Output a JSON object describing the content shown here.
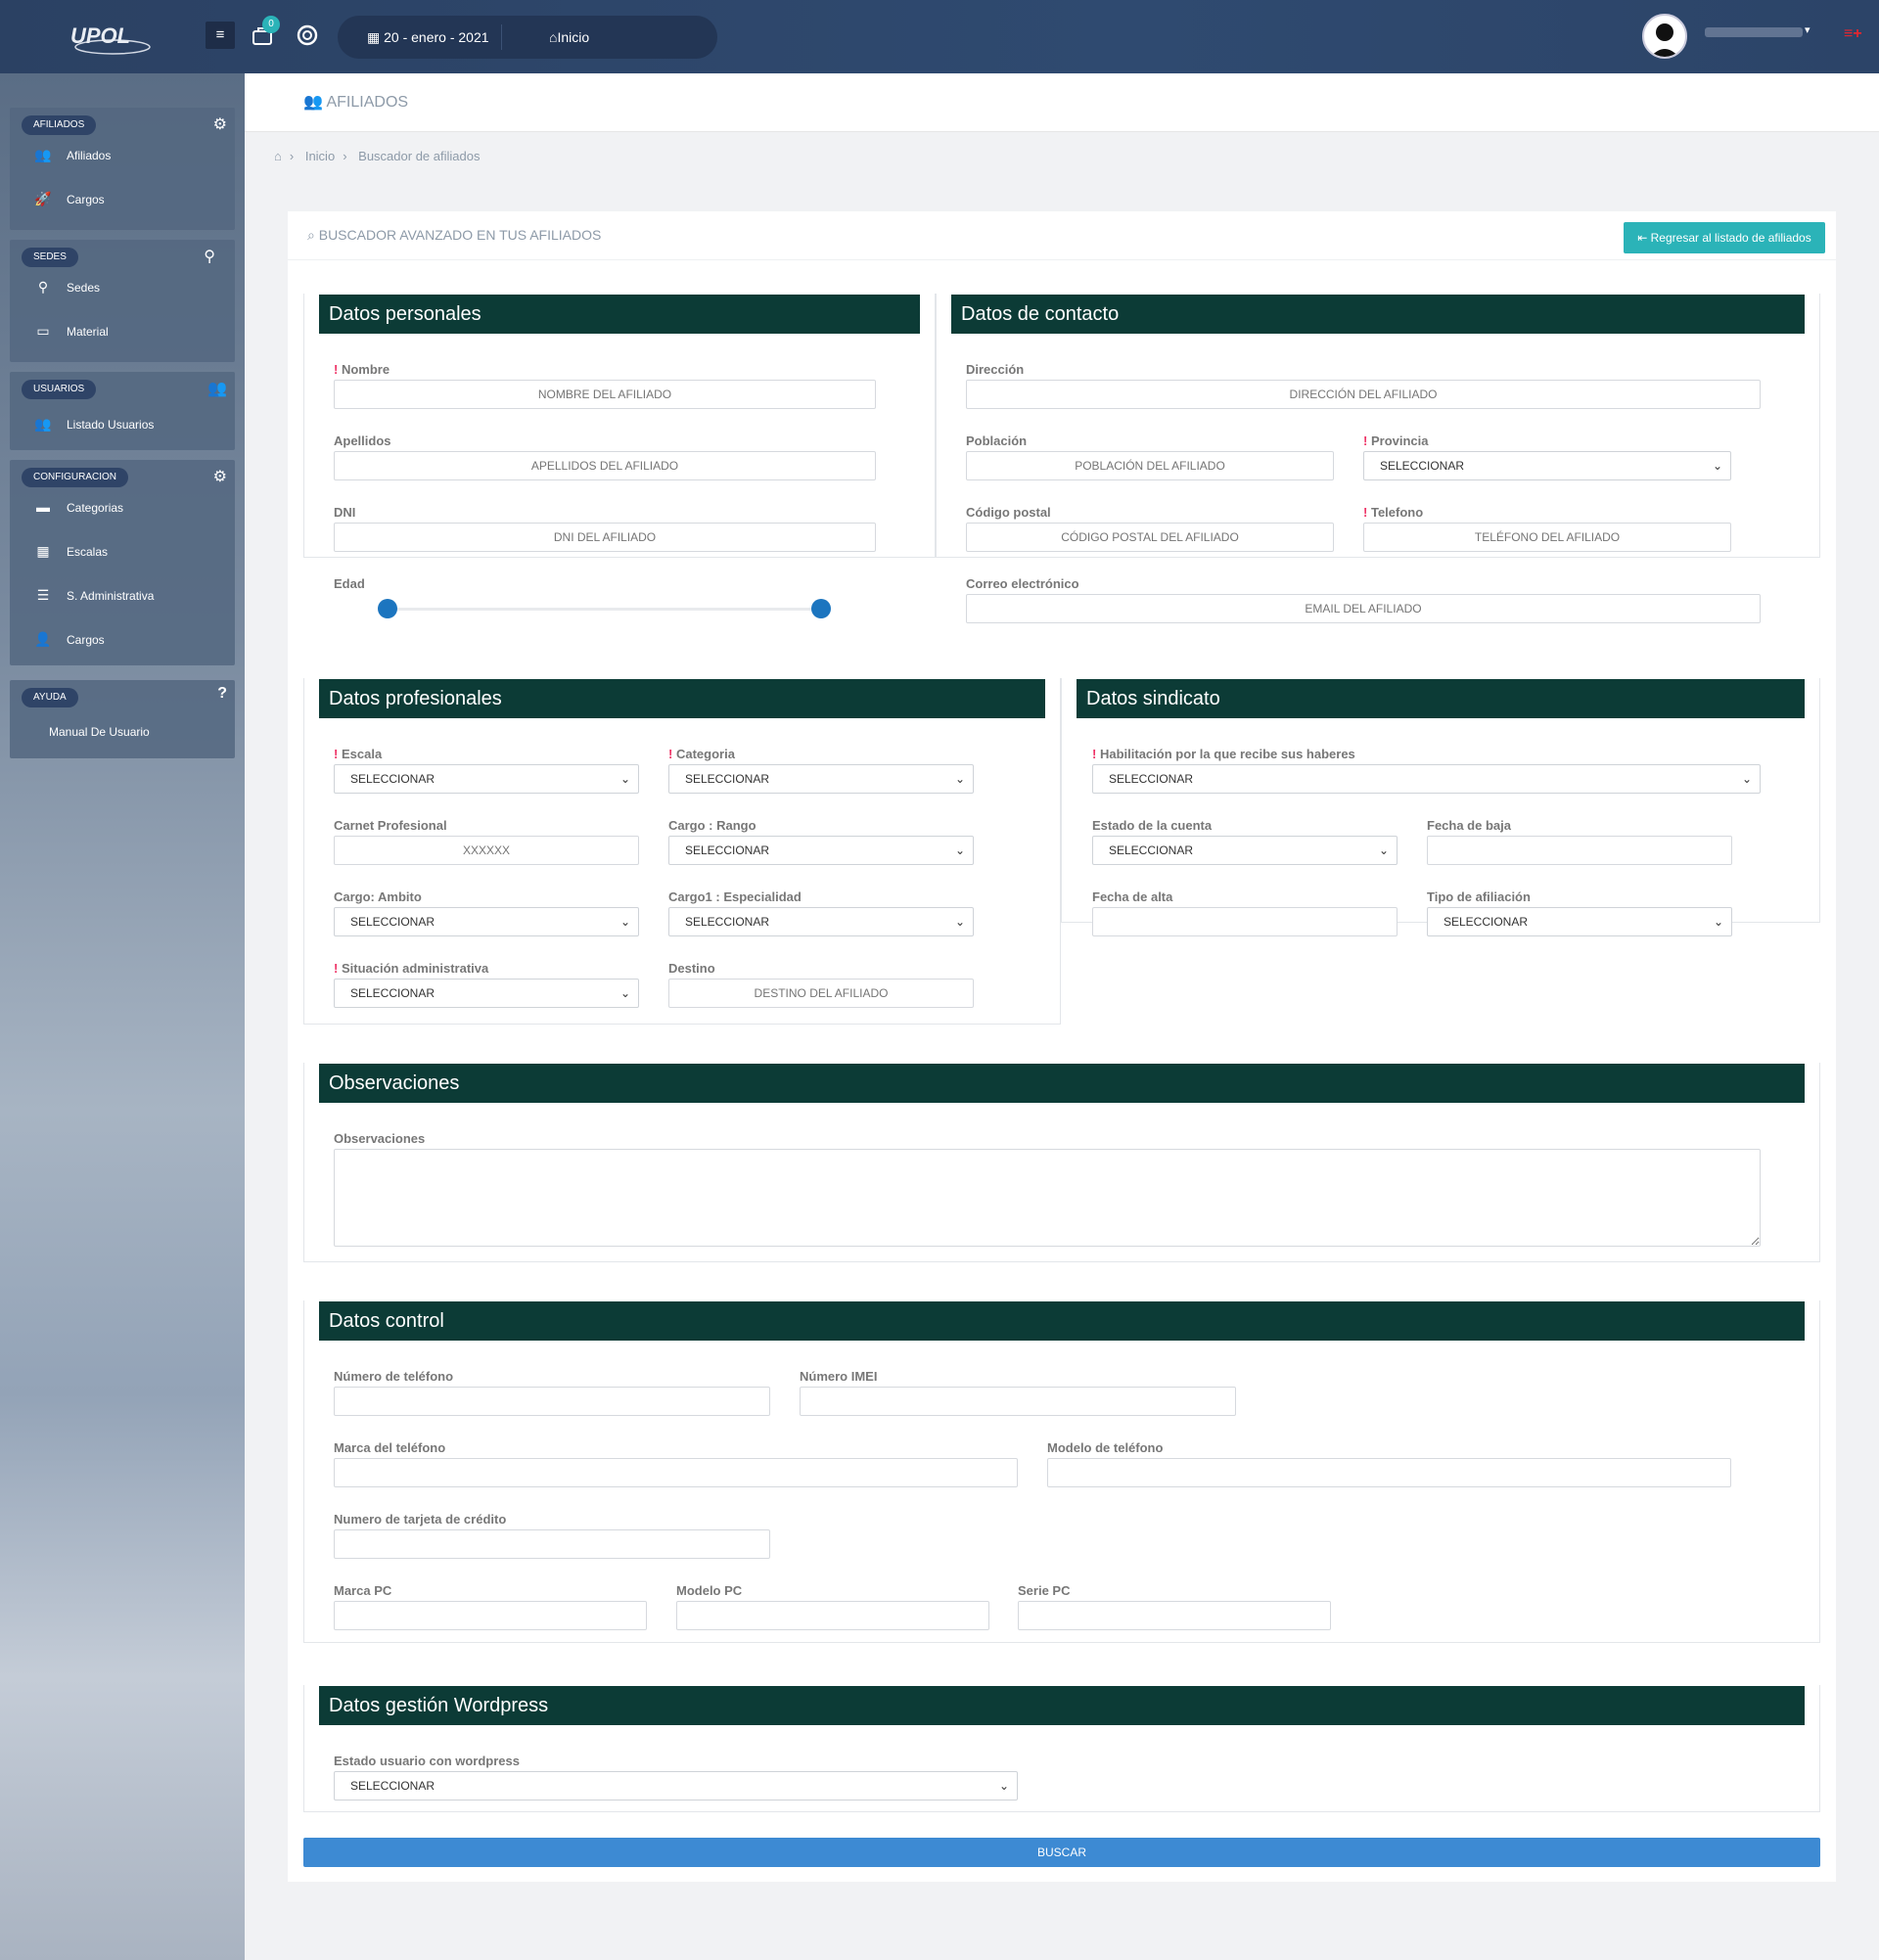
{
  "topbar": {
    "logo_text": "UPOL",
    "badge_count": "0",
    "date": "20 - enero - 2021",
    "home_label": "Inicio",
    "menu_icon": "menu-icon",
    "cart_icon": "briefcase-icon",
    "support_icon": "lifebuoy-icon",
    "exit_icon": "logout-icon"
  },
  "sidebar": {
    "groups": [
      {
        "label": "AFILIADOS",
        "icon": "gear-icon",
        "items": [
          {
            "label": "Afiliados",
            "icon": "users-icon"
          },
          {
            "label": "Cargos",
            "icon": "rocket-icon"
          }
        ]
      },
      {
        "label": "SEDES",
        "icon": "map-pin-icon",
        "items": [
          {
            "label": "Sedes",
            "icon": "map-pin-icon"
          },
          {
            "label": "Material",
            "icon": "monitor-icon"
          }
        ]
      },
      {
        "label": "USUARIOS",
        "icon": "users-icon",
        "items": [
          {
            "label": "Listado Usuarios",
            "icon": "users-icon"
          }
        ]
      },
      {
        "label": "CONFIGURACION",
        "icon": "gear-icon",
        "items": [
          {
            "label": "Categorias",
            "icon": "folder-icon"
          },
          {
            "label": "Escalas",
            "icon": "grid-icon"
          },
          {
            "label": "S. Administrativa",
            "icon": "list-icon"
          },
          {
            "label": "Cargos",
            "icon": "user-group-icon"
          }
        ]
      },
      {
        "label": "AYUDA",
        "icon": "question-icon",
        "items": [
          {
            "label": "Manual De Usuario",
            "icon": ""
          }
        ]
      }
    ]
  },
  "page": {
    "title": "AFILIADOS",
    "breadcrumb": [
      "Inicio",
      "Buscador de afiliados"
    ]
  },
  "card": {
    "title": "BUSCADOR AVANZADO EN TUS AFILIADOS",
    "back_button": "Regresar al listado de afiliados",
    "search_button": "BUSCAR"
  },
  "required_mark": "!",
  "select_default": "SELECCIONAR",
  "personal": {
    "title": "Datos personales",
    "nombre_label": "Nombre",
    "nombre_ph": "NOMBRE DEL AFILIADO",
    "apellidos_label": "Apellidos",
    "apellidos_ph": "APELLIDOS DEL AFILIADO",
    "dni_label": "DNI",
    "dni_ph": "DNI DEL AFILIADO",
    "edad_label": "Edad"
  },
  "contacto": {
    "title": "Datos de contacto",
    "direccion_label": "Dirección",
    "direccion_ph": "DIRECCIÓN DEL AFILIADO",
    "poblacion_label": "Población",
    "poblacion_ph": "POBLACIÓN DEL AFILIADO",
    "provincia_label": "Provincia",
    "cp_label": "Código postal",
    "cp_ph": "CÓDIGO POSTAL DEL AFILIADO",
    "telefono_label": "Telefono",
    "telefono_ph": "TELÉFONO DEL AFILIADO",
    "correo_label": "Correo electrónico",
    "correo_ph": "EMAIL DEL AFILIADO"
  },
  "profesional": {
    "title": "Datos profesionales",
    "escala_label": "Escala",
    "categoria_label": "Categoria",
    "carnet_label": "Carnet Profesional",
    "carnet_ph": "XXXXXX",
    "rango_label": "Cargo : Rango",
    "ambito_label": "Cargo: Ambito",
    "especialidad_label": "Cargo1 : Especialidad",
    "situacion_label": "Situación administrativa",
    "destino_label": "Destino",
    "destino_ph": "DESTINO DEL AFILIADO"
  },
  "sindicato": {
    "title": "Datos sindicato",
    "habilitacion_label": "Habilitación por la que recibe sus haberes",
    "estado_label": "Estado de la cuenta",
    "baja_label": "Fecha de baja",
    "alta_label": "Fecha de alta",
    "tipo_label": "Tipo de afiliación"
  },
  "observaciones": {
    "title": "Observaciones",
    "label": "Observaciones"
  },
  "control": {
    "title": "Datos control",
    "numero_label": "Número de teléfono",
    "imei_label": "Número IMEI",
    "marca_tel_label": "Marca del teléfono",
    "modelo_tel_label": "Modelo de teléfono",
    "tarjeta_label": "Numero de tarjeta de crédito",
    "marca_pc_label": "Marca PC",
    "modelo_pc_label": "Modelo PC",
    "serie_pc_label": "Serie PC"
  },
  "wordpress": {
    "title": "Datos gestión Wordpress",
    "estado_label": "Estado usuario con wordpress"
  },
  "colors": {
    "topbar": "#2b4163",
    "section_header": "#0c3b36",
    "accent": "#2bb3b8",
    "primary": "#3d8ad3",
    "slider": "#1c75bf"
  }
}
